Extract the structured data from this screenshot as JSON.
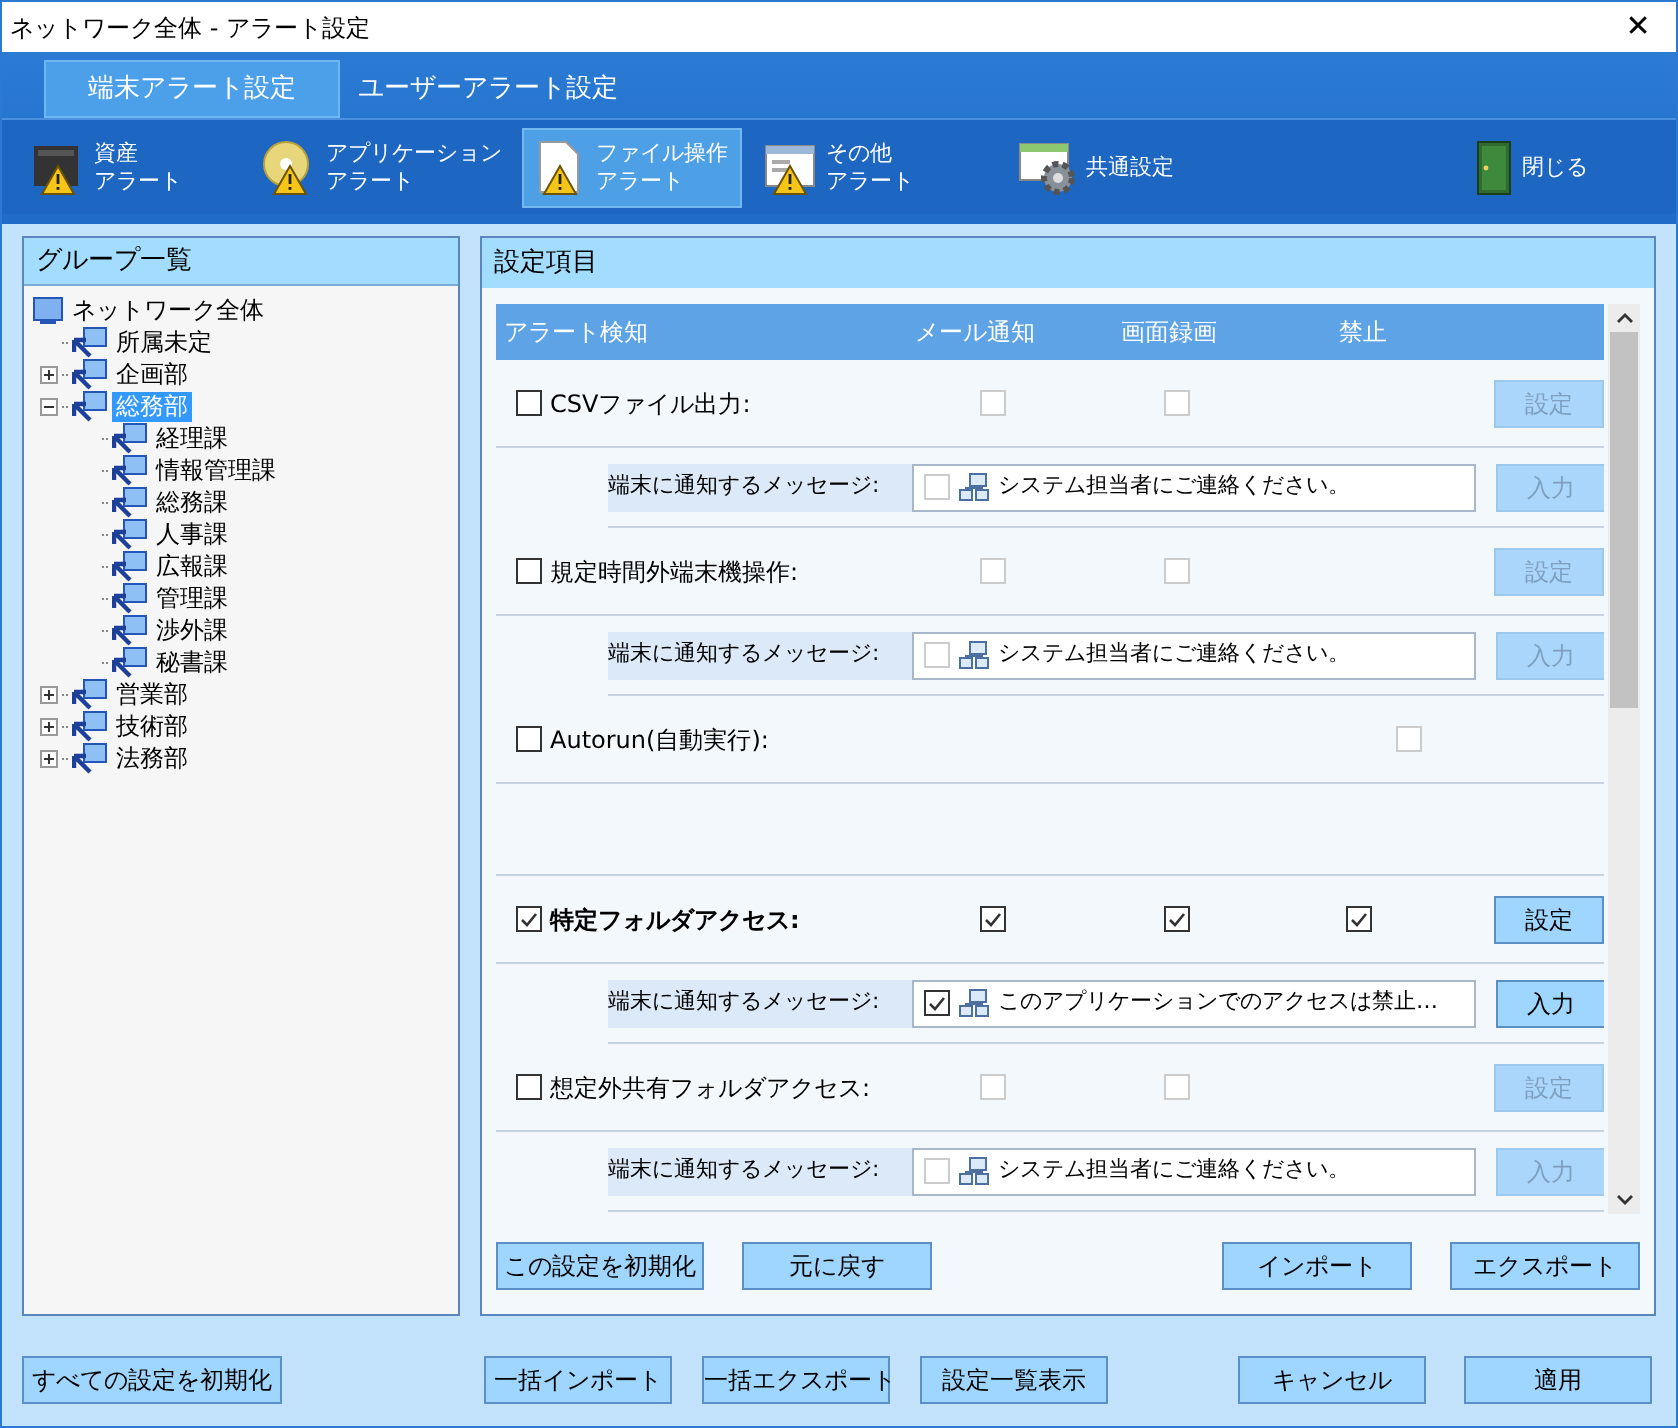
{
  "window": {
    "title": "ネットワーク全体 - アラート設定",
    "close": "✕"
  },
  "tabs": [
    {
      "label": "端末アラート設定",
      "selected": true
    },
    {
      "label": "ユーザーアラート設定",
      "selected": false
    }
  ],
  "toolbar": [
    {
      "kind": "disk",
      "lines": [
        "資産",
        "アラート"
      ],
      "selected": false
    },
    {
      "kind": "cd",
      "lines": [
        "アプリケーション",
        "アラート"
      ],
      "selected": false
    },
    {
      "kind": "file",
      "lines": [
        "ファイル操作",
        "アラート"
      ],
      "selected": true
    },
    {
      "kind": "window",
      "lines": [
        "その他",
        "アラート"
      ],
      "selected": false
    },
    {
      "kind": "gear",
      "lines": [
        "共通設定"
      ],
      "selected": false
    },
    {
      "kind": "door",
      "lines": [
        "閉じる"
      ],
      "selected": false
    }
  ],
  "group_panel": {
    "title": "グループ一覧",
    "tree": [
      {
        "label": "ネットワーク全体",
        "selected": false,
        "children": [
          {
            "label": "所属未定",
            "selected": false
          },
          {
            "label": "企画部",
            "selected": false,
            "expanded": false
          },
          {
            "label": "総務部",
            "selected": true,
            "expanded": true,
            "children": [
              {
                "label": "経理課",
                "selected": false
              },
              {
                "label": "情報管理課",
                "selected": false
              },
              {
                "label": "総務課",
                "selected": false
              },
              {
                "label": "人事課",
                "selected": false
              },
              {
                "label": "広報課",
                "selected": false
              },
              {
                "label": "管理課",
                "selected": false
              },
              {
                "label": "渉外課",
                "selected": false
              },
              {
                "label": "秘書課",
                "selected": false
              }
            ]
          },
          {
            "label": "営業部",
            "selected": false,
            "expanded": false
          },
          {
            "label": "技術部",
            "selected": false,
            "expanded": false
          },
          {
            "label": "法務部",
            "selected": false,
            "expanded": false
          }
        ]
      }
    ]
  },
  "settings_panel": {
    "title": "設定項目",
    "columns": [
      "アラート検知",
      "メール通知",
      "画面録画",
      "禁止"
    ],
    "rows": [
      {
        "label": "CSVファイル出力:",
        "checked": false,
        "mail": false,
        "record": false,
        "button": "設定",
        "message": {
          "label": "端末に通知するメッセージ:",
          "checked": false,
          "text": "システム担当者にご連絡ください。",
          "button": "入力"
        }
      },
      {
        "label": "規定時間外端末機操作:",
        "checked": false,
        "mail": false,
        "record": false,
        "button": "設定",
        "message": {
          "label": "端末に通知するメッセージ:",
          "checked": false,
          "text": "システム担当者にご連絡ください。",
          "button": "入力"
        }
      },
      {
        "label": "Autorun(自動実行):",
        "checked": false,
        "ban": false
      },
      {
        "label": "特定フォルダアクセス:",
        "checked": true,
        "mail": true,
        "record": true,
        "ban": true,
        "button": "設定",
        "message": {
          "label": "端末に通知するメッセージ:",
          "checked": true,
          "text": "このアプリケーションでのアクセスは禁止…",
          "button": "入力"
        }
      },
      {
        "label": "想定外共有フォルダアクセス:",
        "checked": false,
        "mail": false,
        "record": false,
        "button": "設定",
        "message": {
          "label": "端末に通知するメッセージ:",
          "checked": false,
          "text": "システム担当者にご連絡ください。",
          "button": "入力"
        }
      }
    ],
    "left_buttons": [
      "この設定を初期化",
      "元に戻す"
    ],
    "right_buttons": [
      "インポート",
      "エクスポート"
    ]
  },
  "footer": {
    "left": [
      "すべての設定を初期化"
    ],
    "middle": [
      "一括インポート",
      "一括エクスポート",
      "設定一覧表示"
    ],
    "right": [
      "キャンセル",
      "適用"
    ]
  }
}
